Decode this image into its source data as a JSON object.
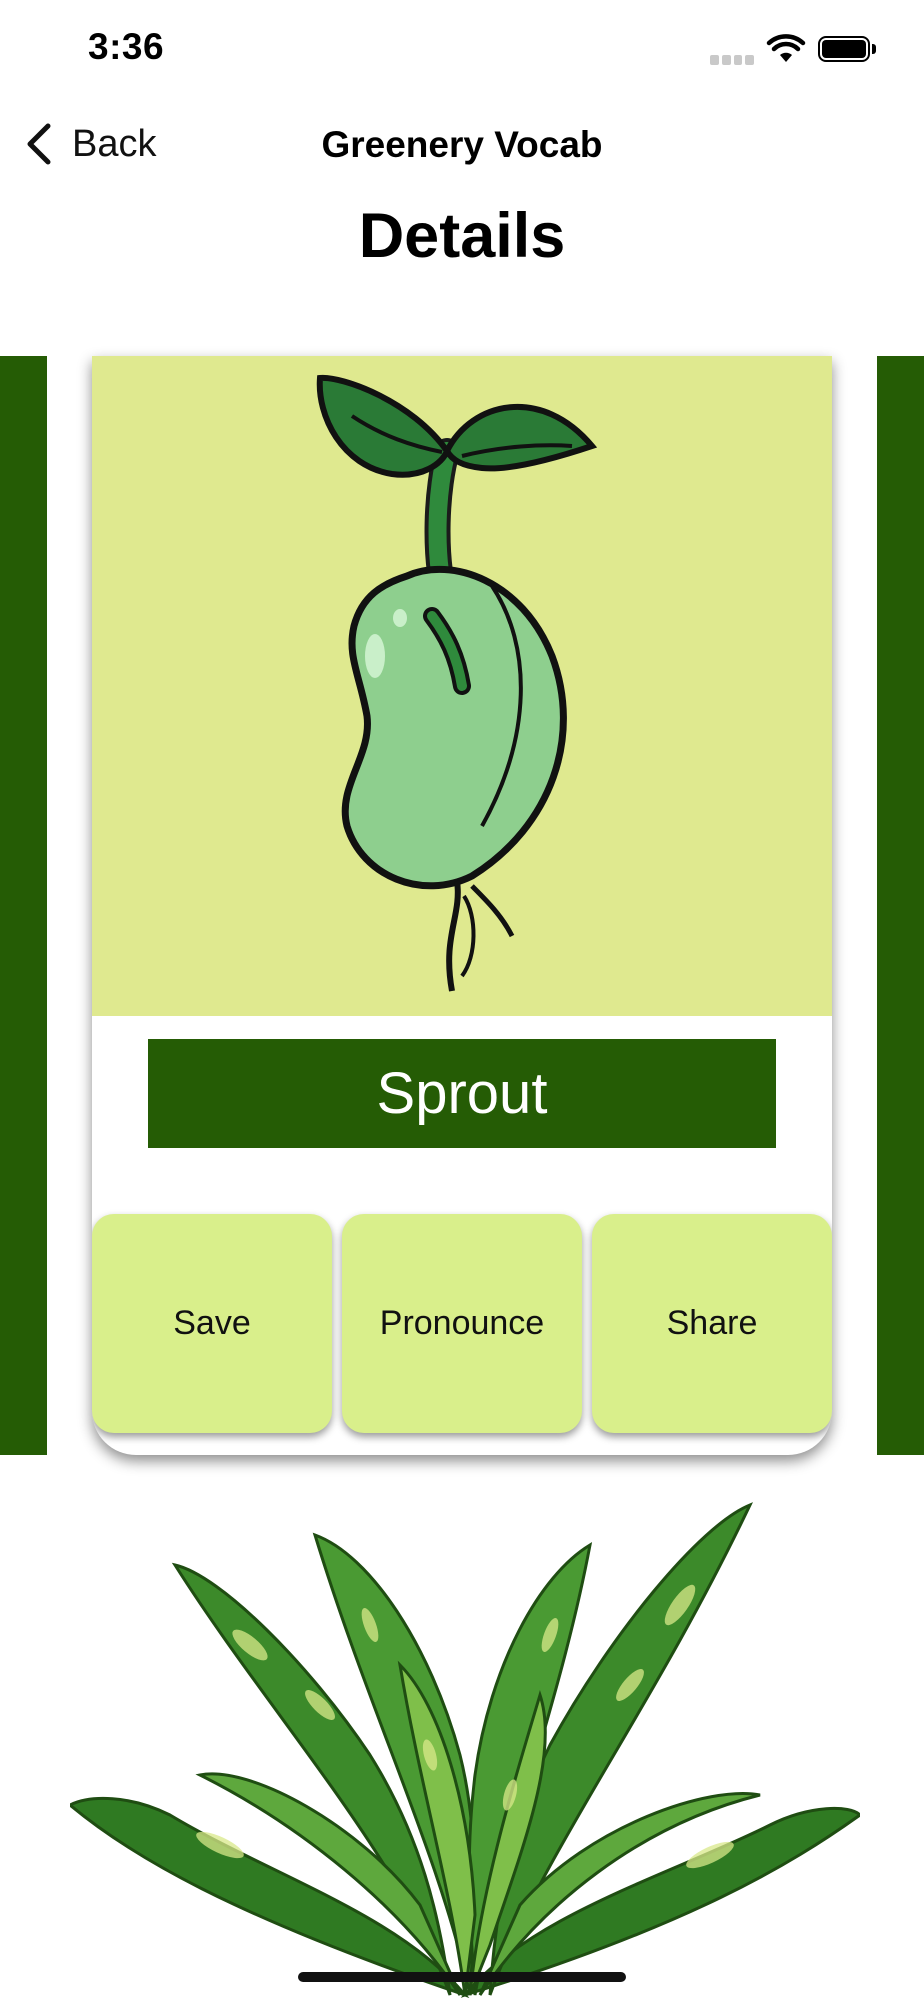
{
  "status_bar": {
    "time": "3:36",
    "wifi_icon": "wifi-icon",
    "battery_icon": "battery-icon"
  },
  "nav": {
    "back_label": "Back",
    "back_icon": "chevron-left-icon",
    "title": "Greenery Vocab"
  },
  "page": {
    "title": "Details"
  },
  "card": {
    "illustration": "sprouting-bean-illustration",
    "word": "Sprout",
    "actions": [
      "Save",
      "Pronounce",
      "Share"
    ]
  },
  "footer_image": "leafy-houseplant-image",
  "colors": {
    "dark_green": "#255c05",
    "image_bg": "#dfe98f",
    "button_bg": "#d9ef8b"
  }
}
